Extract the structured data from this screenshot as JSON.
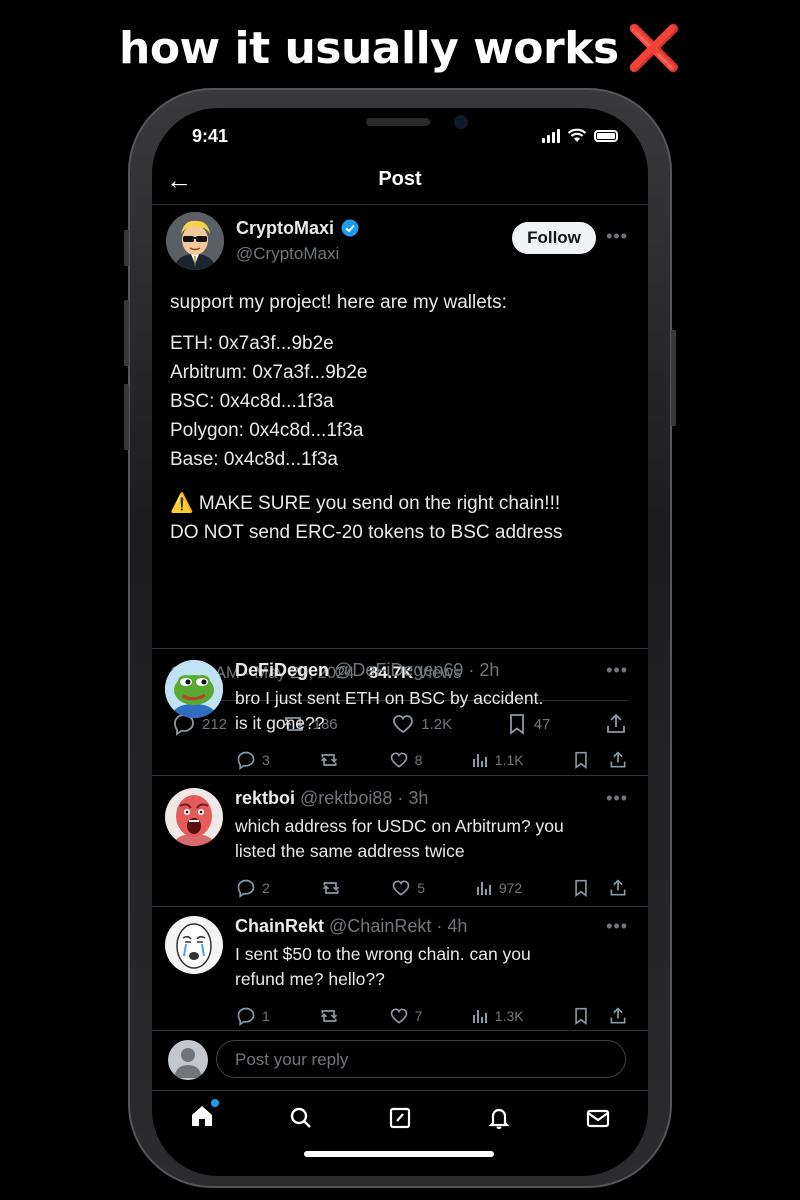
{
  "headline": {
    "text": "how it usually works",
    "mark": "❌"
  },
  "status_bar": {
    "time": "9:41"
  },
  "nav": {
    "title": "Post"
  },
  "post": {
    "author_name": "CryptoMaxi",
    "author_handle": "@CryptoMaxi",
    "follow_label": "Follow",
    "intro": "support my project! here are my wallets:",
    "wallets": [
      "ETH: 0x7a3f...9b2e",
      "Arbitrum: 0x7a3f...9b2e",
      "BSC: 0x4c8d...1f3a",
      "Polygon: 0x4c8d...1f3a",
      "Base: 0x4c8d...1f3a"
    ],
    "warning_line1": "⚠️ MAKE SURE you send on the right chain!!!",
    "warning_line2": "DO NOT send ERC-20 tokens to BSC address",
    "timestamp": "10:32 AM · May 20, 2024 · ",
    "views_count": "84.7K",
    "views_label": " Views",
    "stats": {
      "replies": "212",
      "reposts": "186",
      "likes": "1.2K",
      "bookmarks": "47"
    }
  },
  "replies": [
    {
      "name": "DeFiDegen",
      "handle": "@DeFiDegen69 · 2h",
      "line1": "bro I just sent ETH on BSC by accident.",
      "line2": "is it gone??",
      "replies": "3",
      "likes": "8",
      "views": "1.1K",
      "avatar_icon": "frog-avatar-icon"
    },
    {
      "name": "rektboi",
      "handle": "@rektboi88 · 3h",
      "line1": "which address for USDC on Arbitrum? you",
      "line2": "listed the same address twice",
      "replies": "2",
      "likes": "5",
      "views": "972",
      "avatar_icon": "screaming-face-avatar-icon"
    },
    {
      "name": "ChainRekt",
      "handle": "@ChainRekt · 4h",
      "line1": "I sent $50 to the wrong chain. can you",
      "line2": "refund me? hello??",
      "replies": "1",
      "likes": "7",
      "views": "1.3K",
      "avatar_icon": "crying-wojak-avatar-icon"
    }
  ],
  "reply_box": {
    "placeholder": "Post your reply"
  },
  "colors": {
    "accent": "#1d9bf0",
    "background": "#000000",
    "muted": "#71767b",
    "divider": "#2f3336",
    "cross": "#e0212e"
  }
}
